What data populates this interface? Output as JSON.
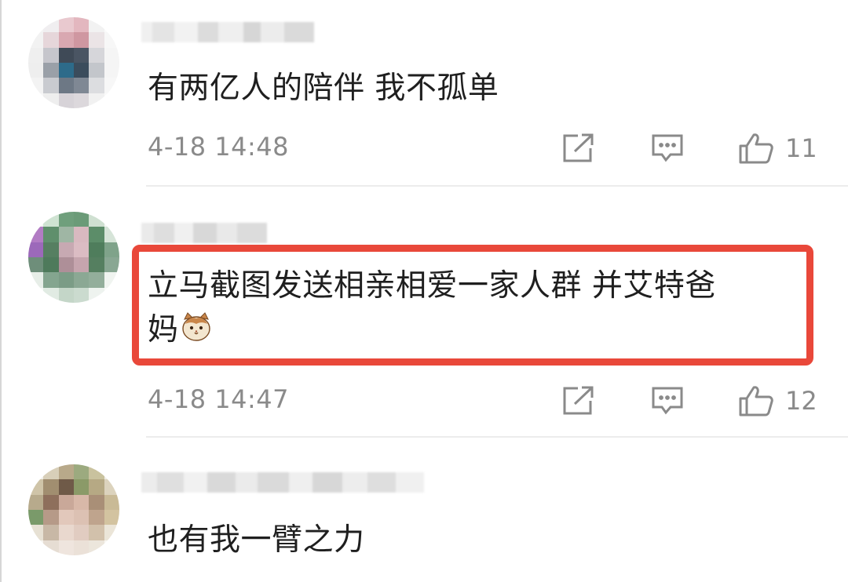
{
  "comments": [
    {
      "text": "有两亿人的陪伴 我不孤单",
      "time": "4-18 14:48",
      "likes": "11",
      "highlighted": false
    },
    {
      "text_line1": "立马截图发送相亲相爱一家人群 并艾特爸",
      "text_line2": "妈",
      "time": "4-18 14:47",
      "likes": "12",
      "highlighted": true
    },
    {
      "text": "也有我一臂之力",
      "highlighted": false
    }
  ],
  "icons": {
    "share": "share-icon",
    "reply": "comment-icon",
    "like": "thumbs-up-icon",
    "emoji": "cat-emoji-icon"
  },
  "colors": {
    "highlight_border": "#e9483a",
    "meta_text": "#8a8a8a",
    "body_text": "#1f1f1f",
    "divider": "#ececec"
  }
}
